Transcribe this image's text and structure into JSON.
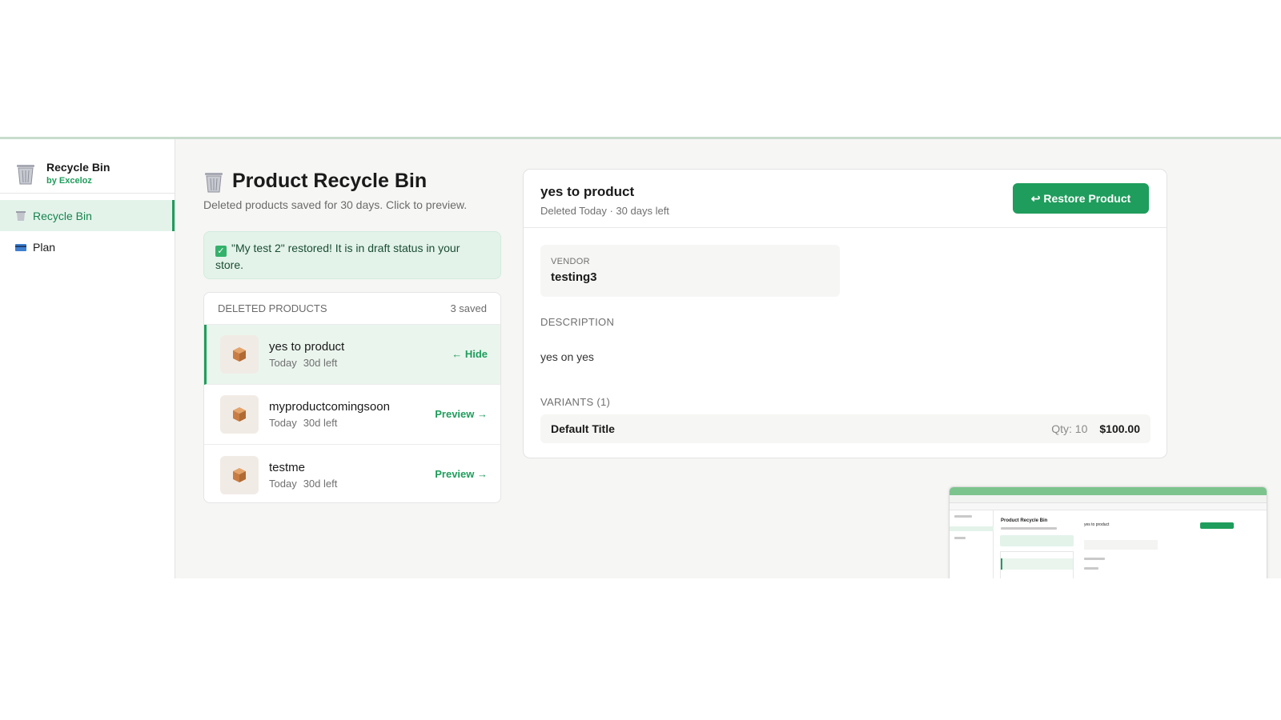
{
  "sidebar": {
    "brand_title": "Recycle Bin",
    "brand_sub": "by Exceloz",
    "brand_icon": "trash-bin-icon",
    "items": [
      {
        "label": "Recycle Bin",
        "icon": "trash-bin-icon",
        "active": true
      },
      {
        "label": "Plan",
        "icon": "credit-card-icon",
        "active": false
      }
    ]
  },
  "page": {
    "title": "Product Recycle Bin",
    "subtitle": "Deleted products saved for 30 days. Click to preview.",
    "banner": "\"My test 2\" restored! It is in draft status in your store."
  },
  "list": {
    "header": "DELETED PRODUCTS",
    "count": "3 saved",
    "items": [
      {
        "name": "yes to product",
        "date": "Today",
        "left": "30d left",
        "action": "← Hide",
        "selected": true
      },
      {
        "name": "myproductcomingsoon",
        "date": "Today",
        "left": "30d left",
        "action": "Preview →",
        "selected": false
      },
      {
        "name": "testme",
        "date": "Today",
        "left": "30d left",
        "action": "Preview →",
        "selected": false
      }
    ]
  },
  "detail": {
    "title": "yes to product",
    "meta": "Deleted Today · 30 days left",
    "restore_label": "↩ Restore Product",
    "vendor_label": "VENDOR",
    "vendor_value": "testing3",
    "description_label": "DESCRIPTION",
    "description_value": "yes on yes",
    "variants_label": "VARIANTS (1)",
    "variants": [
      {
        "title": "Default Title",
        "qty": "Qty: 10",
        "price": "$100.00"
      }
    ]
  },
  "thumbnail": {
    "title": "Product Recycle Bin",
    "detail_title": "yes to product"
  },
  "colors": {
    "accent": "#1f9d5c",
    "accent_light": "#e3f3ea",
    "page_bg": "#f6f6f4"
  }
}
